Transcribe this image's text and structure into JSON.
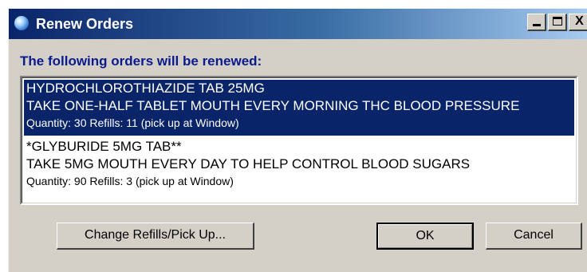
{
  "window": {
    "title": "Renew Orders",
    "controls": {
      "minimize": "_",
      "maximize": "□",
      "close": "X"
    }
  },
  "heading": "The following orders will be renewed:",
  "orders": [
    {
      "drug": "HYDROCHLOROTHIAZIDE TAB  25MG",
      "sig": "TAKE ONE-HALF TABLET MOUTH EVERY MORNING THC BLOOD PRESSURE",
      "details": "Quantity: 30 Refills: 11 (pick up at Window)",
      "selected": true
    },
    {
      "drug": "*GLYBURIDE 5MG TAB**",
      "sig": "TAKE 5MG MOUTH EVERY DAY TO HELP CONTROL BLOOD SUGARS",
      "details": "Quantity: 90 Refills: 3 (pick up at Window)",
      "selected": false
    }
  ],
  "buttons": {
    "change_refills": "Change Refills/Pick Up...",
    "ok": "OK",
    "cancel": "Cancel"
  },
  "colors": {
    "title_bar_start": "#0a246a",
    "title_bar_end": "#a6caf0",
    "heading": "#0a1a8c",
    "selection": "#0a246a",
    "face": "#d4d0c8"
  },
  "icons": {
    "app": "app-globe-icon",
    "minimize": "minimize-icon",
    "maximize": "maximize-icon",
    "close": "close-icon"
  }
}
